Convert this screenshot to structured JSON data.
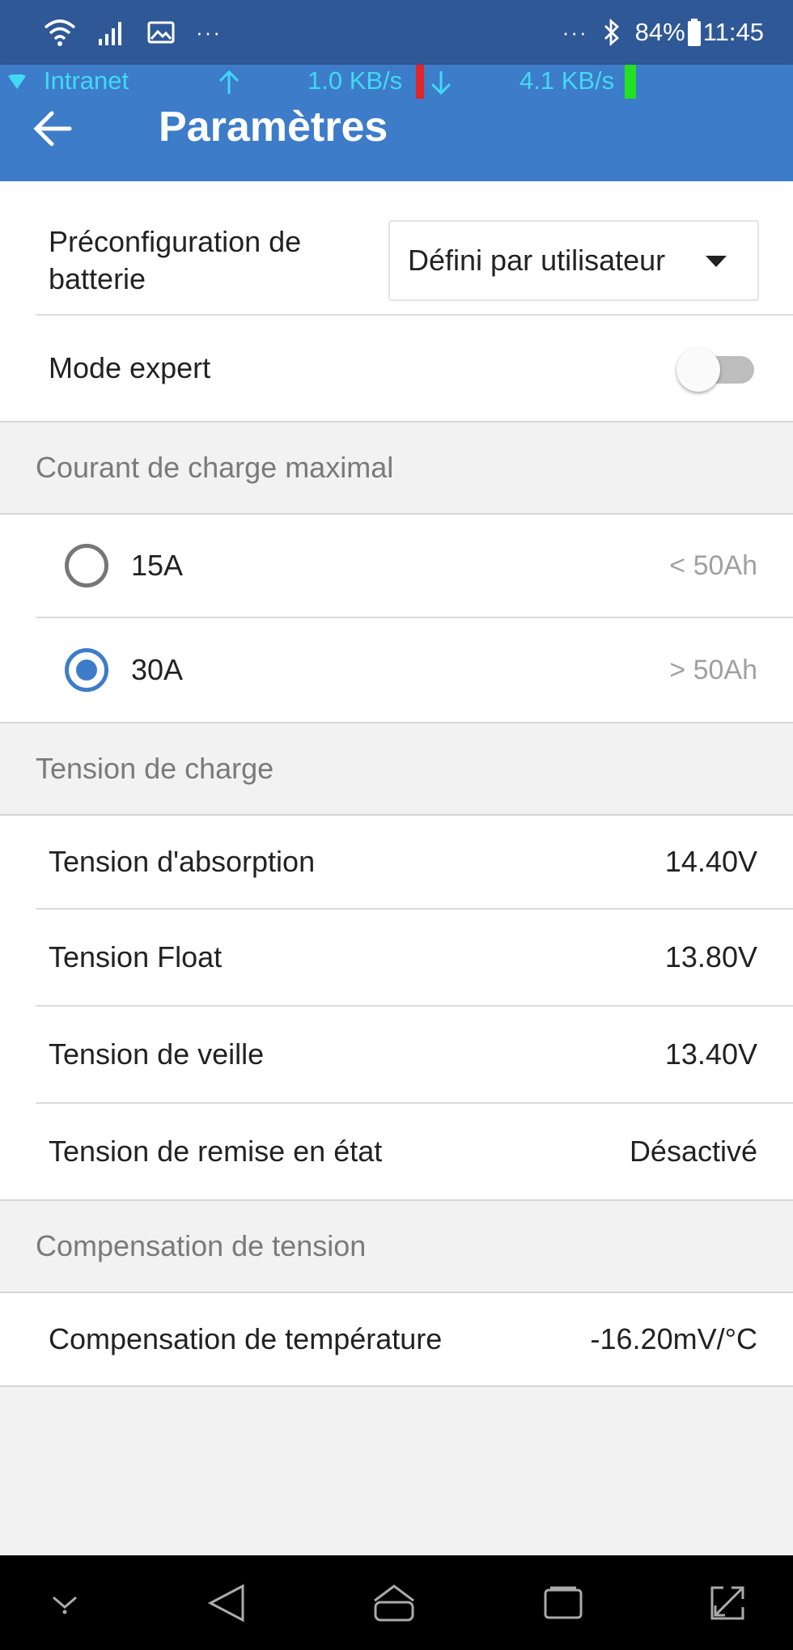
{
  "status_bar": {
    "battery": "84%",
    "time": "11:45",
    "dots_left": "···",
    "dots_right": "···"
  },
  "network": {
    "name": "Intranet",
    "upload": "1.0 KB/s",
    "download": "4.1 KB/s",
    "up_marker_color": "#e0262a",
    "down_marker_color": "#22e022"
  },
  "header": {
    "title": "Paramètres"
  },
  "battery_preset": {
    "label": "Préconfiguration de batterie",
    "value": "Défini par utilisateur"
  },
  "expert_mode": {
    "label": "Mode expert",
    "enabled": false
  },
  "max_charge_current": {
    "header": "Courant de charge maximal",
    "options": [
      {
        "label": "15A",
        "hint": "< 50Ah",
        "selected": false
      },
      {
        "label": "30A",
        "hint": "> 50Ah",
        "selected": true
      }
    ]
  },
  "charge_voltage": {
    "header": "Tension de charge",
    "items": [
      {
        "label": "Tension d'absorption",
        "value": "14.40V"
      },
      {
        "label": "Tension Float",
        "value": "13.80V"
      },
      {
        "label": "Tension de veille",
        "value": "13.40V"
      },
      {
        "label": "Tension de remise en état",
        "value": "Désactivé"
      }
    ]
  },
  "voltage_compensation": {
    "header": "Compensation de tension",
    "items": [
      {
        "label": "Compensation de température",
        "value": "-16.20mV/°C"
      }
    ]
  },
  "colors": {
    "accent": "#3d7cc9",
    "status_bar": "#2f5896",
    "network_text": "#41d9f5"
  }
}
